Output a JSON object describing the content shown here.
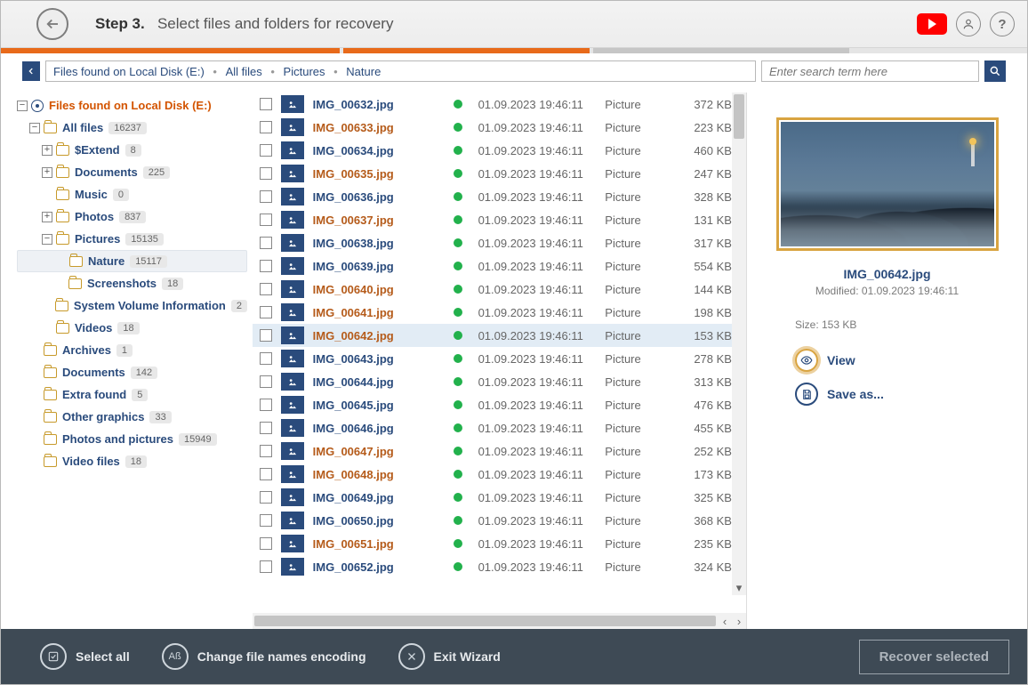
{
  "header": {
    "step_label": "Step 3.",
    "step_text": "Select files and folders for recovery"
  },
  "breadcrumb": {
    "parts": [
      "Files found on Local Disk (E:)",
      "All files",
      "Pictures",
      "Nature"
    ]
  },
  "search": {
    "placeholder": "Enter search term here"
  },
  "tree": {
    "root": "Files found on Local Disk (E:)",
    "allfiles": {
      "label": "All files",
      "count": "16237"
    },
    "extend": {
      "label": "$Extend",
      "count": "8"
    },
    "documents": {
      "label": "Documents",
      "count": "225"
    },
    "music": {
      "label": "Music",
      "count": "0"
    },
    "photos": {
      "label": "Photos",
      "count": "837"
    },
    "pictures": {
      "label": "Pictures",
      "count": "15135"
    },
    "nature": {
      "label": "Nature",
      "count": "15117"
    },
    "screenshots": {
      "label": "Screenshots",
      "count": "18"
    },
    "svi": {
      "label": "System Volume Information",
      "count": "2"
    },
    "videos": {
      "label": "Videos",
      "count": "18"
    },
    "archives": {
      "label": "Archives",
      "count": "1"
    },
    "documents2": {
      "label": "Documents",
      "count": "142"
    },
    "extra": {
      "label": "Extra found",
      "count": "5"
    },
    "othergfx": {
      "label": "Other graphics",
      "count": "33"
    },
    "photospics": {
      "label": "Photos and pictures",
      "count": "15949"
    },
    "videofiles": {
      "label": "Video files",
      "count": "18"
    }
  },
  "files": [
    {
      "name": "IMG_00632.jpg",
      "brown": false,
      "date": "01.09.2023 19:46:11",
      "type": "Picture",
      "size": "372 KB"
    },
    {
      "name": "IMG_00633.jpg",
      "brown": true,
      "date": "01.09.2023 19:46:11",
      "type": "Picture",
      "size": "223 KB"
    },
    {
      "name": "IMG_00634.jpg",
      "brown": false,
      "date": "01.09.2023 19:46:11",
      "type": "Picture",
      "size": "460 KB"
    },
    {
      "name": "IMG_00635.jpg",
      "brown": true,
      "date": "01.09.2023 19:46:11",
      "type": "Picture",
      "size": "247 KB"
    },
    {
      "name": "IMG_00636.jpg",
      "brown": false,
      "date": "01.09.2023 19:46:11",
      "type": "Picture",
      "size": "328 KB"
    },
    {
      "name": "IMG_00637.jpg",
      "brown": true,
      "date": "01.09.2023 19:46:11",
      "type": "Picture",
      "size": "131 KB"
    },
    {
      "name": "IMG_00638.jpg",
      "brown": false,
      "date": "01.09.2023 19:46:11",
      "type": "Picture",
      "size": "317 KB"
    },
    {
      "name": "IMG_00639.jpg",
      "brown": false,
      "date": "01.09.2023 19:46:11",
      "type": "Picture",
      "size": "554 KB"
    },
    {
      "name": "IMG_00640.jpg",
      "brown": true,
      "date": "01.09.2023 19:46:11",
      "type": "Picture",
      "size": "144 KB"
    },
    {
      "name": "IMG_00641.jpg",
      "brown": true,
      "date": "01.09.2023 19:46:11",
      "type": "Picture",
      "size": "198 KB"
    },
    {
      "name": "IMG_00642.jpg",
      "brown": true,
      "date": "01.09.2023 19:46:11",
      "type": "Picture",
      "size": "153 KB",
      "selected": true
    },
    {
      "name": "IMG_00643.jpg",
      "brown": false,
      "date": "01.09.2023 19:46:11",
      "type": "Picture",
      "size": "278 KB"
    },
    {
      "name": "IMG_00644.jpg",
      "brown": false,
      "date": "01.09.2023 19:46:11",
      "type": "Picture",
      "size": "313 KB"
    },
    {
      "name": "IMG_00645.jpg",
      "brown": false,
      "date": "01.09.2023 19:46:11",
      "type": "Picture",
      "size": "476 KB"
    },
    {
      "name": "IMG_00646.jpg",
      "brown": false,
      "date": "01.09.2023 19:46:11",
      "type": "Picture",
      "size": "455 KB"
    },
    {
      "name": "IMG_00647.jpg",
      "brown": true,
      "date": "01.09.2023 19:46:11",
      "type": "Picture",
      "size": "252 KB"
    },
    {
      "name": "IMG_00648.jpg",
      "brown": true,
      "date": "01.09.2023 19:46:11",
      "type": "Picture",
      "size": "173 KB"
    },
    {
      "name": "IMG_00649.jpg",
      "brown": false,
      "date": "01.09.2023 19:46:11",
      "type": "Picture",
      "size": "325 KB"
    },
    {
      "name": "IMG_00650.jpg",
      "brown": false,
      "date": "01.09.2023 19:46:11",
      "type": "Picture",
      "size": "368 KB"
    },
    {
      "name": "IMG_00651.jpg",
      "brown": true,
      "date": "01.09.2023 19:46:11",
      "type": "Picture",
      "size": "235 KB"
    },
    {
      "name": "IMG_00652.jpg",
      "brown": false,
      "date": "01.09.2023 19:46:11",
      "type": "Picture",
      "size": "324 KB"
    }
  ],
  "preview": {
    "name": "IMG_00642.jpg",
    "modified_label": "Modified: 01.09.2023 19:46:11",
    "size_label": "Size: 153 KB",
    "view": "View",
    "saveas": "Save as..."
  },
  "footer": {
    "select_all": "Select all",
    "change_enc": "Change file names encoding",
    "exit": "Exit Wizard",
    "recover": "Recover selected"
  }
}
